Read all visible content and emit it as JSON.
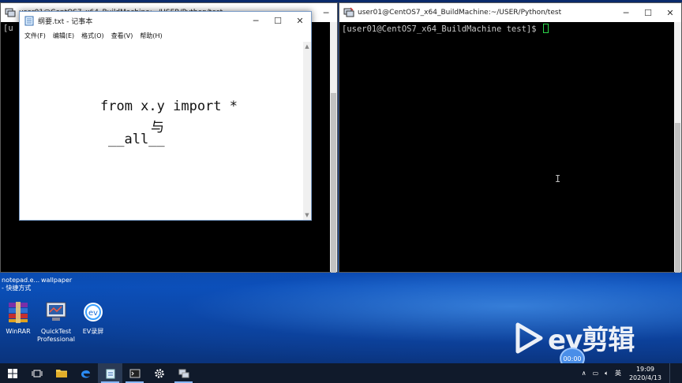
{
  "left_terminal": {
    "title": "user01@CentOS7_x64_BuildMachine:~/USER/Python/test",
    "prompt_fragment": "[u"
  },
  "right_terminal": {
    "title": "user01@CentOS7_x64_BuildMachine:~/USER/Python/test",
    "prompt": "[user01@CentOS7_x64_BuildMachine test]$ "
  },
  "notepad": {
    "title": "纲要.txt - 记事本",
    "menu": [
      "文件(F)",
      "编辑(E)",
      "格式(O)",
      "查看(V)",
      "帮助(H)"
    ],
    "lines": [
      "from x.y import *",
      "与",
      "__all__"
    ]
  },
  "desktop": {
    "labels_top": [
      "notepad.e...",
      "- 快捷方式",
      "wallpaper"
    ],
    "icons": [
      {
        "name": "winrar",
        "label": "WinRAR"
      },
      {
        "name": "quicktest",
        "label": "QuickTest Professional"
      },
      {
        "name": "ev-recorder",
        "label": "EV录屏"
      }
    ]
  },
  "watermark": {
    "text": "ev剪辑",
    "timer": "00:00"
  },
  "taskbar": {
    "tray": {
      "lang": "英",
      "time": "19:09",
      "date": "2020/4/13"
    }
  },
  "colors": {
    "cursor": "#2bd64a",
    "taskbar": "#101a2b",
    "desktop": "#0b3a8e"
  }
}
